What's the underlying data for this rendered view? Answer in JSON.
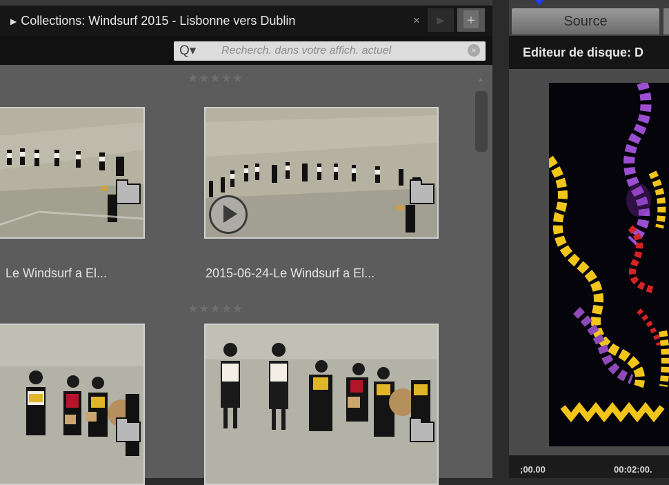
{
  "library": {
    "collection_title": "Collections: Windsurf  2015 - Lisbonne vers Dublin",
    "close_glyph": "×",
    "add_glyph": "+",
    "search": {
      "icon_label": "Q▾",
      "placeholder": "Recherch. dans votre affich. actuel",
      "clear_glyph": "×"
    },
    "items": [
      {
        "caption": "Le Windsurf a El...",
        "stars": "★★★★★",
        "video": false
      },
      {
        "caption": "2015-06-24-Le Windsurf a El...",
        "stars": "★★★★★",
        "video": true
      },
      {
        "caption": "",
        "stars": "★★★★★",
        "video": false
      },
      {
        "caption": "",
        "stars": "",
        "video": false
      }
    ],
    "scroll_up_glyph": "▲"
  },
  "editor": {
    "source_tab": "Source",
    "title": "Editeur de disque: D",
    "timeline": {
      "start": ";00.00",
      "mark": "00:02:00."
    }
  },
  "colors": {
    "ribbon_yellow": "#f2c51a",
    "ribbon_purple": "#9a4fd0",
    "ribbon_red": "#d42326"
  },
  "icons": [
    "search-icon",
    "close-icon",
    "add-icon",
    "folder-icon",
    "play-icon",
    "scroll-up-icon"
  ]
}
